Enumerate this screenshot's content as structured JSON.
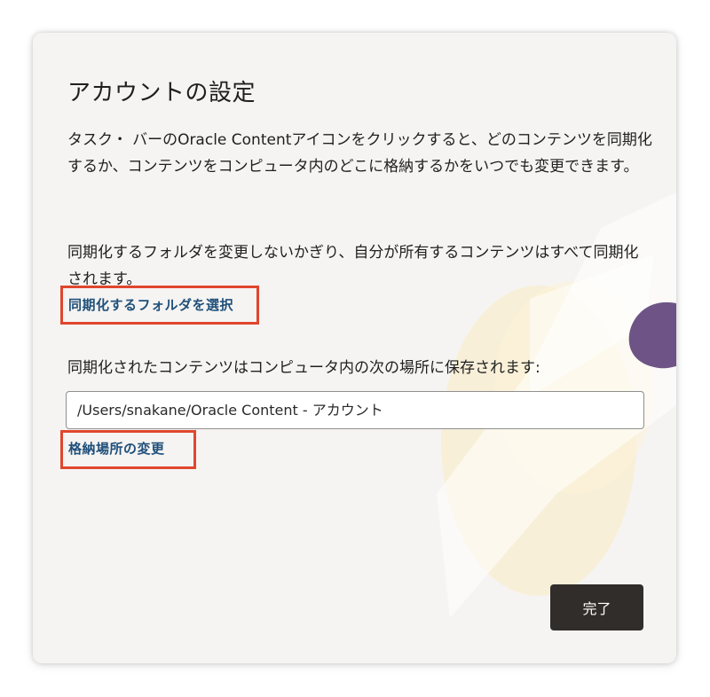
{
  "dialog": {
    "title": "アカウントの設定",
    "intro_text": "タスク・ バーのOracle Contentアイコンをクリックすると、どのコンテンツを同期化するか、コンテンツをコンピュータ内のどこに格納するかをいつでも変更できます。",
    "sync_info_text": "同期化するフォルダを変更しないかぎり、自分が所有するコンテンツはすべて同期化されます。",
    "select_folders_link": "同期化するフォルダを選択",
    "storage_info_text": "同期化されたコンテンツはコンピュータ内の次の場所に保存されます:",
    "storage_path": "/Users/snakane/Oracle Content - アカウント",
    "change_location_link": "格納場所の変更",
    "done_button": "完了"
  },
  "colors": {
    "dialog_background": "#f5f4f2",
    "link": "#20507a",
    "highlight_border": "#e0462d",
    "button_background": "#312d2a",
    "decoration_purple": "#6e5486",
    "decoration_yellow": "#f8edcf"
  }
}
